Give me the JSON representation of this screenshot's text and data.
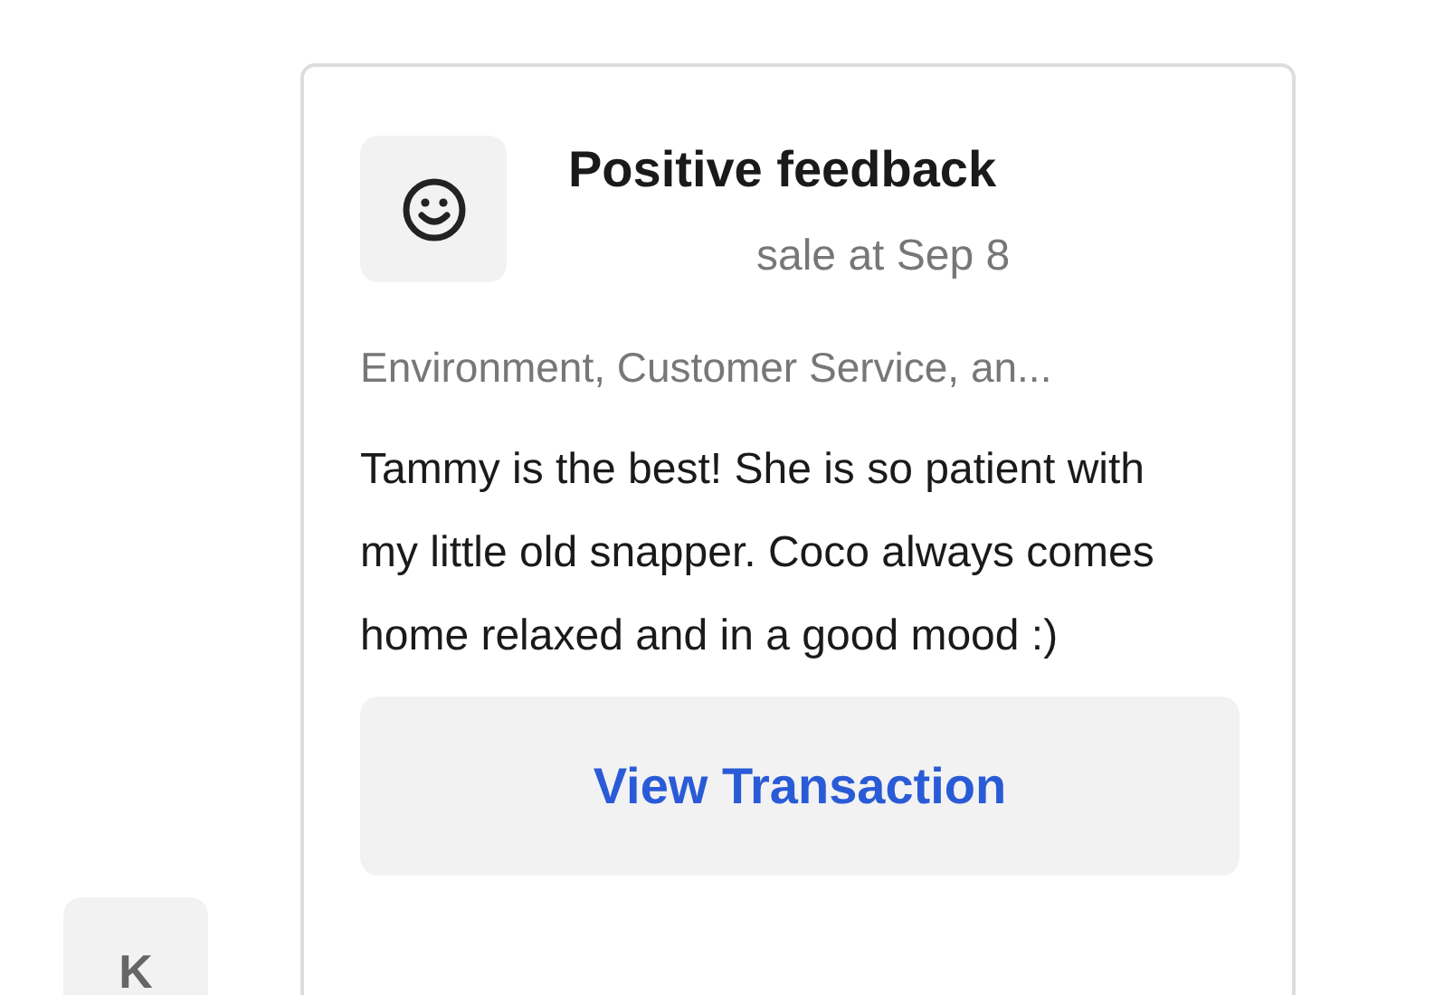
{
  "side_item": {
    "label": "K"
  },
  "card": {
    "title": "Positive feedback",
    "subtitle": "sale at Sep 8",
    "tags": "Environment, Customer Service, an...",
    "comment": "Tammy is the best! She is so patient with my little old snapper. Coco always comes home relaxed and in a good mood :)",
    "button": "View Transaction"
  }
}
